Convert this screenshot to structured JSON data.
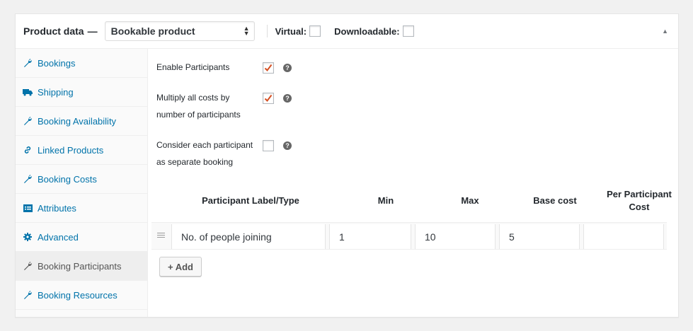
{
  "header": {
    "title": "Product data",
    "separator": "—",
    "product_type": "Bookable product",
    "virtual_label": "Virtual:",
    "downloadable_label": "Downloadable:",
    "collapse_glyph": "▲"
  },
  "sidebar": {
    "items": [
      {
        "label": "Bookings",
        "icon": "wrench-icon"
      },
      {
        "label": "Shipping",
        "icon": "truck-icon"
      },
      {
        "label": "Booking Availability",
        "icon": "wrench-icon"
      },
      {
        "label": "Linked Products",
        "icon": "link-icon"
      },
      {
        "label": "Booking Costs",
        "icon": "wrench-icon"
      },
      {
        "label": "Attributes",
        "icon": "list-icon"
      },
      {
        "label": "Advanced",
        "icon": "gear-icon"
      },
      {
        "label": "Booking Participants",
        "icon": "wrench-icon",
        "active": true
      },
      {
        "label": "Booking Resources",
        "icon": "wrench-icon"
      }
    ]
  },
  "fields": {
    "enable_participants": {
      "label": "Enable Participants",
      "checked": true
    },
    "multiply_costs": {
      "line1": "Multiply all costs by",
      "line2": "number of participants",
      "checked": true
    },
    "separate_booking": {
      "line1": "Consider each participant",
      "line2": "as separate booking",
      "checked": false
    },
    "help_glyph": "?"
  },
  "table": {
    "headers": {
      "label": "Participant Label/Type",
      "min": "Min",
      "max": "Max",
      "base_cost": "Base cost",
      "per_participant_line1": "Per Participant",
      "per_participant_line2": "Cost"
    },
    "rows": [
      {
        "label": "No. of people joining",
        "min": "1",
        "max": "10",
        "base_cost": "5",
        "per_participant_cost": ""
      }
    ]
  },
  "buttons": {
    "add": "+ Add"
  },
  "colors": {
    "link": "#0073aa",
    "check": "#d54e21"
  }
}
